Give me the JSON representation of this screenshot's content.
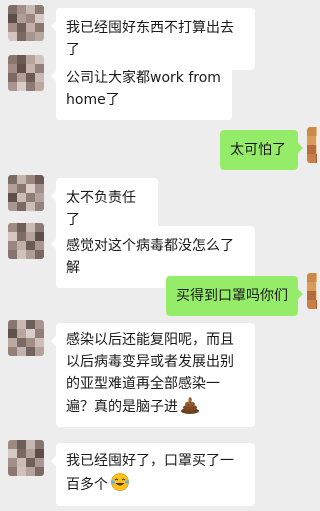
{
  "messages": [
    {
      "side": "left",
      "text": "我已经囤好东西不打算出去了"
    },
    {
      "side": "left",
      "text": "公司让大家都work from home了"
    },
    {
      "side": "right",
      "text": "太可怕了"
    },
    {
      "side": "left",
      "text": "太不负责任了"
    },
    {
      "side": "left",
      "text": "感觉对这个病毒都没怎么了解"
    },
    {
      "side": "right",
      "text": "买得到口罩吗你们"
    },
    {
      "side": "left",
      "text": "感染以后还能复阳呢，而且以后病毒变异或者发展出别的亚型难道再全部感染一遍？真的是脑子进",
      "emoji": "poop-emoji"
    },
    {
      "side": "left",
      "text": "我已经囤好了，口罩买了一百多个",
      "emoji": "laughing-crying-emoji"
    }
  ],
  "colors": {
    "background": "#ededed",
    "incoming_bubble": "#ffffff",
    "outgoing_bubble": "#95ec69"
  }
}
